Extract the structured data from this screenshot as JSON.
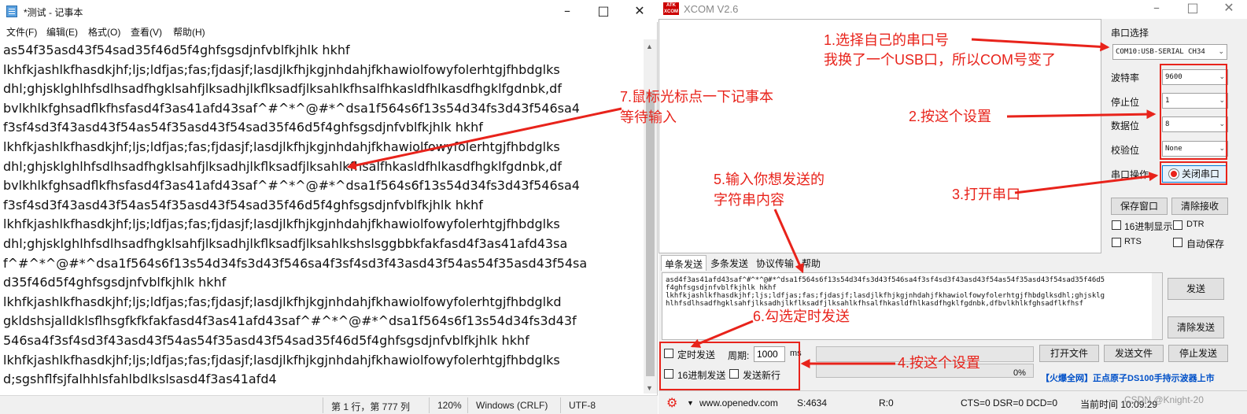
{
  "notepad": {
    "title": "*测试 - 记事本",
    "menu": [
      "文件(F)",
      "编辑(E)",
      "格式(O)",
      "查看(V)",
      "帮助(H)"
    ],
    "lines": [
      "as54f35asd43f54sad35f46d5f4ghfsgsdjnfvblfkjhlk hkhf",
      "lkhfkjashlkfhasdkjhf;ljs;ldfjas;fas;fjdasjf;lasdjlkfhjkgjnhdahjfkhawiolfowyfolerhtgjfhbdglks",
      "dhl;ghjsklghlhfsdlhsadfhgklsahfjlksadhjlkflksadfjlksahlkfhsalfhkasldfhlkasdfhgklfgdnbk,df",
      "bvlkhlkfghsadflkfhsfasd4f3as41afd43saf^#^*^@#*^dsa1f564s6f13s54d34fs3d43f546sa4",
      "f3sf4sd3f43asd43f54as54f35asd43f54sad35f46d5f4ghfsgsdjnfvblfkjhlk hkhf",
      "lkhfkjashlkfhasdkjhf;ljs;ldfjas;fas;fjdasjf;lasdjlkfhjkgjnhdahjfkhawiolfowyfolerhtgjfhbdglks",
      "dhl;ghjsklghlhfsdlhsadfhgklsahfjlksadhjlkflksadfjlksahlkfhsalfhkasldfhlkasdfhgklfgdnbk,df",
      "bvlkhlkfghsadflkfhsfasd4f3as41afd43saf^#^*^@#*^dsa1f564s6f13s54d34fs3d43f546sa4",
      "f3sf4sd3f43asd43f54as54f35asd43f54sad35f46d5f4ghfsgsdjnfvblfkjhlk hkhf",
      "lkhfkjashlkfhasdkjhf;ljs;ldfjas;fas;fjdasjf;lasdjlkfhjkgjnhdahjfkhawiolfowyfolerhtgjfhbdglks",
      "dhl;ghjsklghlhfsdlhsadfhgklsahfjlksadhjlkflksadfjlksahlkshslsggbbkfakfasd4f3as41afd43sa",
      "f^#^*^@#*^dsa1f564s6f13s54d34fs3d43f546sa4f3sf4sd3f43asd43f54as54f35asd43f54sa",
      "d35f46d5f4ghfsgsdjnfvblfkjhlk hkhf",
      "lkhfkjashlkfhasdkjhf;ljs;ldfjas;fas;fjdasjf;lasdjlkfhjkgjnhdahjfkhawiolfowyfolerhtgjfhbdglkd",
      "gkldshsjalldklsflhsgfkfkfakfasd4f3as41afd43saf^#^*^@#*^dsa1f564s6f13s54d34fs3d43f",
      "546sa4f3sf4sd3f43asd43f54as54f35asd43f54sad35f46d5f4ghfsgsdjnfvblfkjhlk hkhf",
      "lkhfkjashlkfhasdkjhf;ljs;ldfjas;fas;fjdasjf;lasdjlkfhjkgjnhdahjfkhawiolfowyfolerhtgjfhbdglks",
      "d;sgshflfsjfalhhlsfahlbdlkslsasd4f3as41afd4"
    ],
    "status": {
      "position": "第 1 行，第 777 列",
      "zoom": "120%",
      "line_ending": "Windows (CRLF)",
      "encoding": "UTF-8"
    }
  },
  "xcom": {
    "logo": "ATK XCOM",
    "title": "XCOM V2.6",
    "serial_select_label": "串口选择",
    "port_value": "COM10:USB-SERIAL CH34",
    "baud_label": "波特率",
    "baud_value": "9600",
    "stopbits_label": "停止位",
    "stopbits_value": "1",
    "databits_label": "数据位",
    "databits_value": "8",
    "parity_label": "校验位",
    "parity_value": "None",
    "serial_op_label": "串口操作",
    "close_port_button": "关闭串口",
    "save_window_button": "保存窗口",
    "clear_recv_button": "清除接收",
    "hex_display": "16进制显示",
    "dtr": "DTR",
    "rts": "RTS",
    "auto_save": "自动保存",
    "tabs": [
      "单条发送",
      "多条发送",
      "协议传输",
      "帮助"
    ],
    "send_text_lines": [
      "asd4f3as41afd43saf^#^*^@#*^dsa1f564s6f13s54d34fs3d43f546sa4f3sf4sd3f43asd43f54as54f35asd43f54sad35f46d5",
      "f4ghfsgsdjnfvblfkjhlk hkhf",
      "lkhfkjashlkfhasdkjhf;ljs;ldfjas;fas;fjdasjf;lasdjlkfhjkgjnhdahjfkhawiolfowyfolerhtgjfhbdglksdhl;ghjsklg",
      "hlhfsdlhsadfhgklsahfjlksadhjlkflksadfjlksahlkfhsalfhkasldfhlkasdfhgklfgdnbk,dfbvlkhlkfghsadflkfhsf"
    ],
    "send_button": "发送",
    "clear_send_button": "清除发送",
    "timed_send": "定时发送",
    "period_label": "周期:",
    "period_value": "1000",
    "period_unit": "ms",
    "open_file_button": "打开文件",
    "send_file_button": "发送文件",
    "stop_send_button": "停止发送",
    "hex_send": "16进制发送",
    "send_newline": "发送新行",
    "progress_text": "0%",
    "ad_text": "【火爆全网】正点原子DS100手持示波器上市",
    "status": {
      "url": "www.openedv.com",
      "s_count": "S:4634",
      "r_count": "R:0",
      "signals": "CTS=0 DSR=0 DCD=0",
      "time": "当前时间 10:09:29"
    },
    "watermark": "CSDN @Knight-20"
  },
  "annotations": {
    "a1_line1": "1.选择自己的串口号",
    "a1_line2": "我换了一个USB口，所以COM号变了",
    "a2": "2.按这个设置",
    "a3": "3.打开串口",
    "a4": "4.按这个设置",
    "a5_line1": "5.输入你想发送的",
    "a5_line2": "字符串内容",
    "a6": "6.勾选定时发送",
    "a7_line1": "7.鼠标光标点一下记事本",
    "a7_line2": "等待输入",
    "color": "#e8231b"
  }
}
